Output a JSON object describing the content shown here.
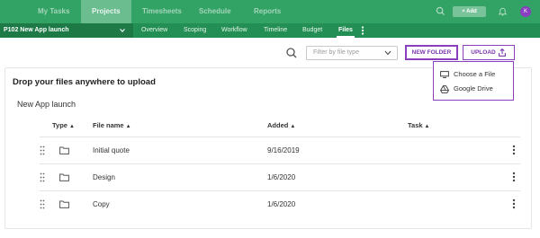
{
  "top_nav": {
    "items": [
      {
        "label": "My Tasks"
      },
      {
        "label": "Projects"
      },
      {
        "label": "Timesheets"
      },
      {
        "label": "Schedule"
      },
      {
        "label": "Reports"
      }
    ],
    "add_label": "+ Add",
    "avatar_initials": "K"
  },
  "sub_nav": {
    "project_name": "P102 New App launch",
    "tabs": [
      {
        "label": "Overview"
      },
      {
        "label": "Scoping"
      },
      {
        "label": "Workflow"
      },
      {
        "label": "Timeline"
      },
      {
        "label": "Budget"
      },
      {
        "label": "Files"
      }
    ],
    "active_tab": "Files"
  },
  "toolbar": {
    "filter_placeholder": "Filter by file type",
    "new_folder_label": "NEW FOLDER",
    "upload_label": "UPLOAD"
  },
  "upload_menu": {
    "items": [
      {
        "label": "Choose a File",
        "icon": "monitor-icon"
      },
      {
        "label": "Google Drive",
        "icon": "google-drive-icon"
      }
    ]
  },
  "files": {
    "drop_text": "Drop your files anywhere to upload",
    "project_title": "New App launch",
    "columns": {
      "type": "Type",
      "file_name": "File name",
      "added": "Added",
      "task": "Task"
    },
    "rows": [
      {
        "name": "Initial quote",
        "added": "9/16/2019",
        "task": ""
      },
      {
        "name": "Design",
        "added": "1/6/2020",
        "task": ""
      },
      {
        "name": "Copy",
        "added": "1/6/2020",
        "task": ""
      }
    ]
  },
  "colors": {
    "brand_green": "#32a364",
    "subnav_green": "#238f55",
    "accent_purple": "#8a3fbf"
  }
}
